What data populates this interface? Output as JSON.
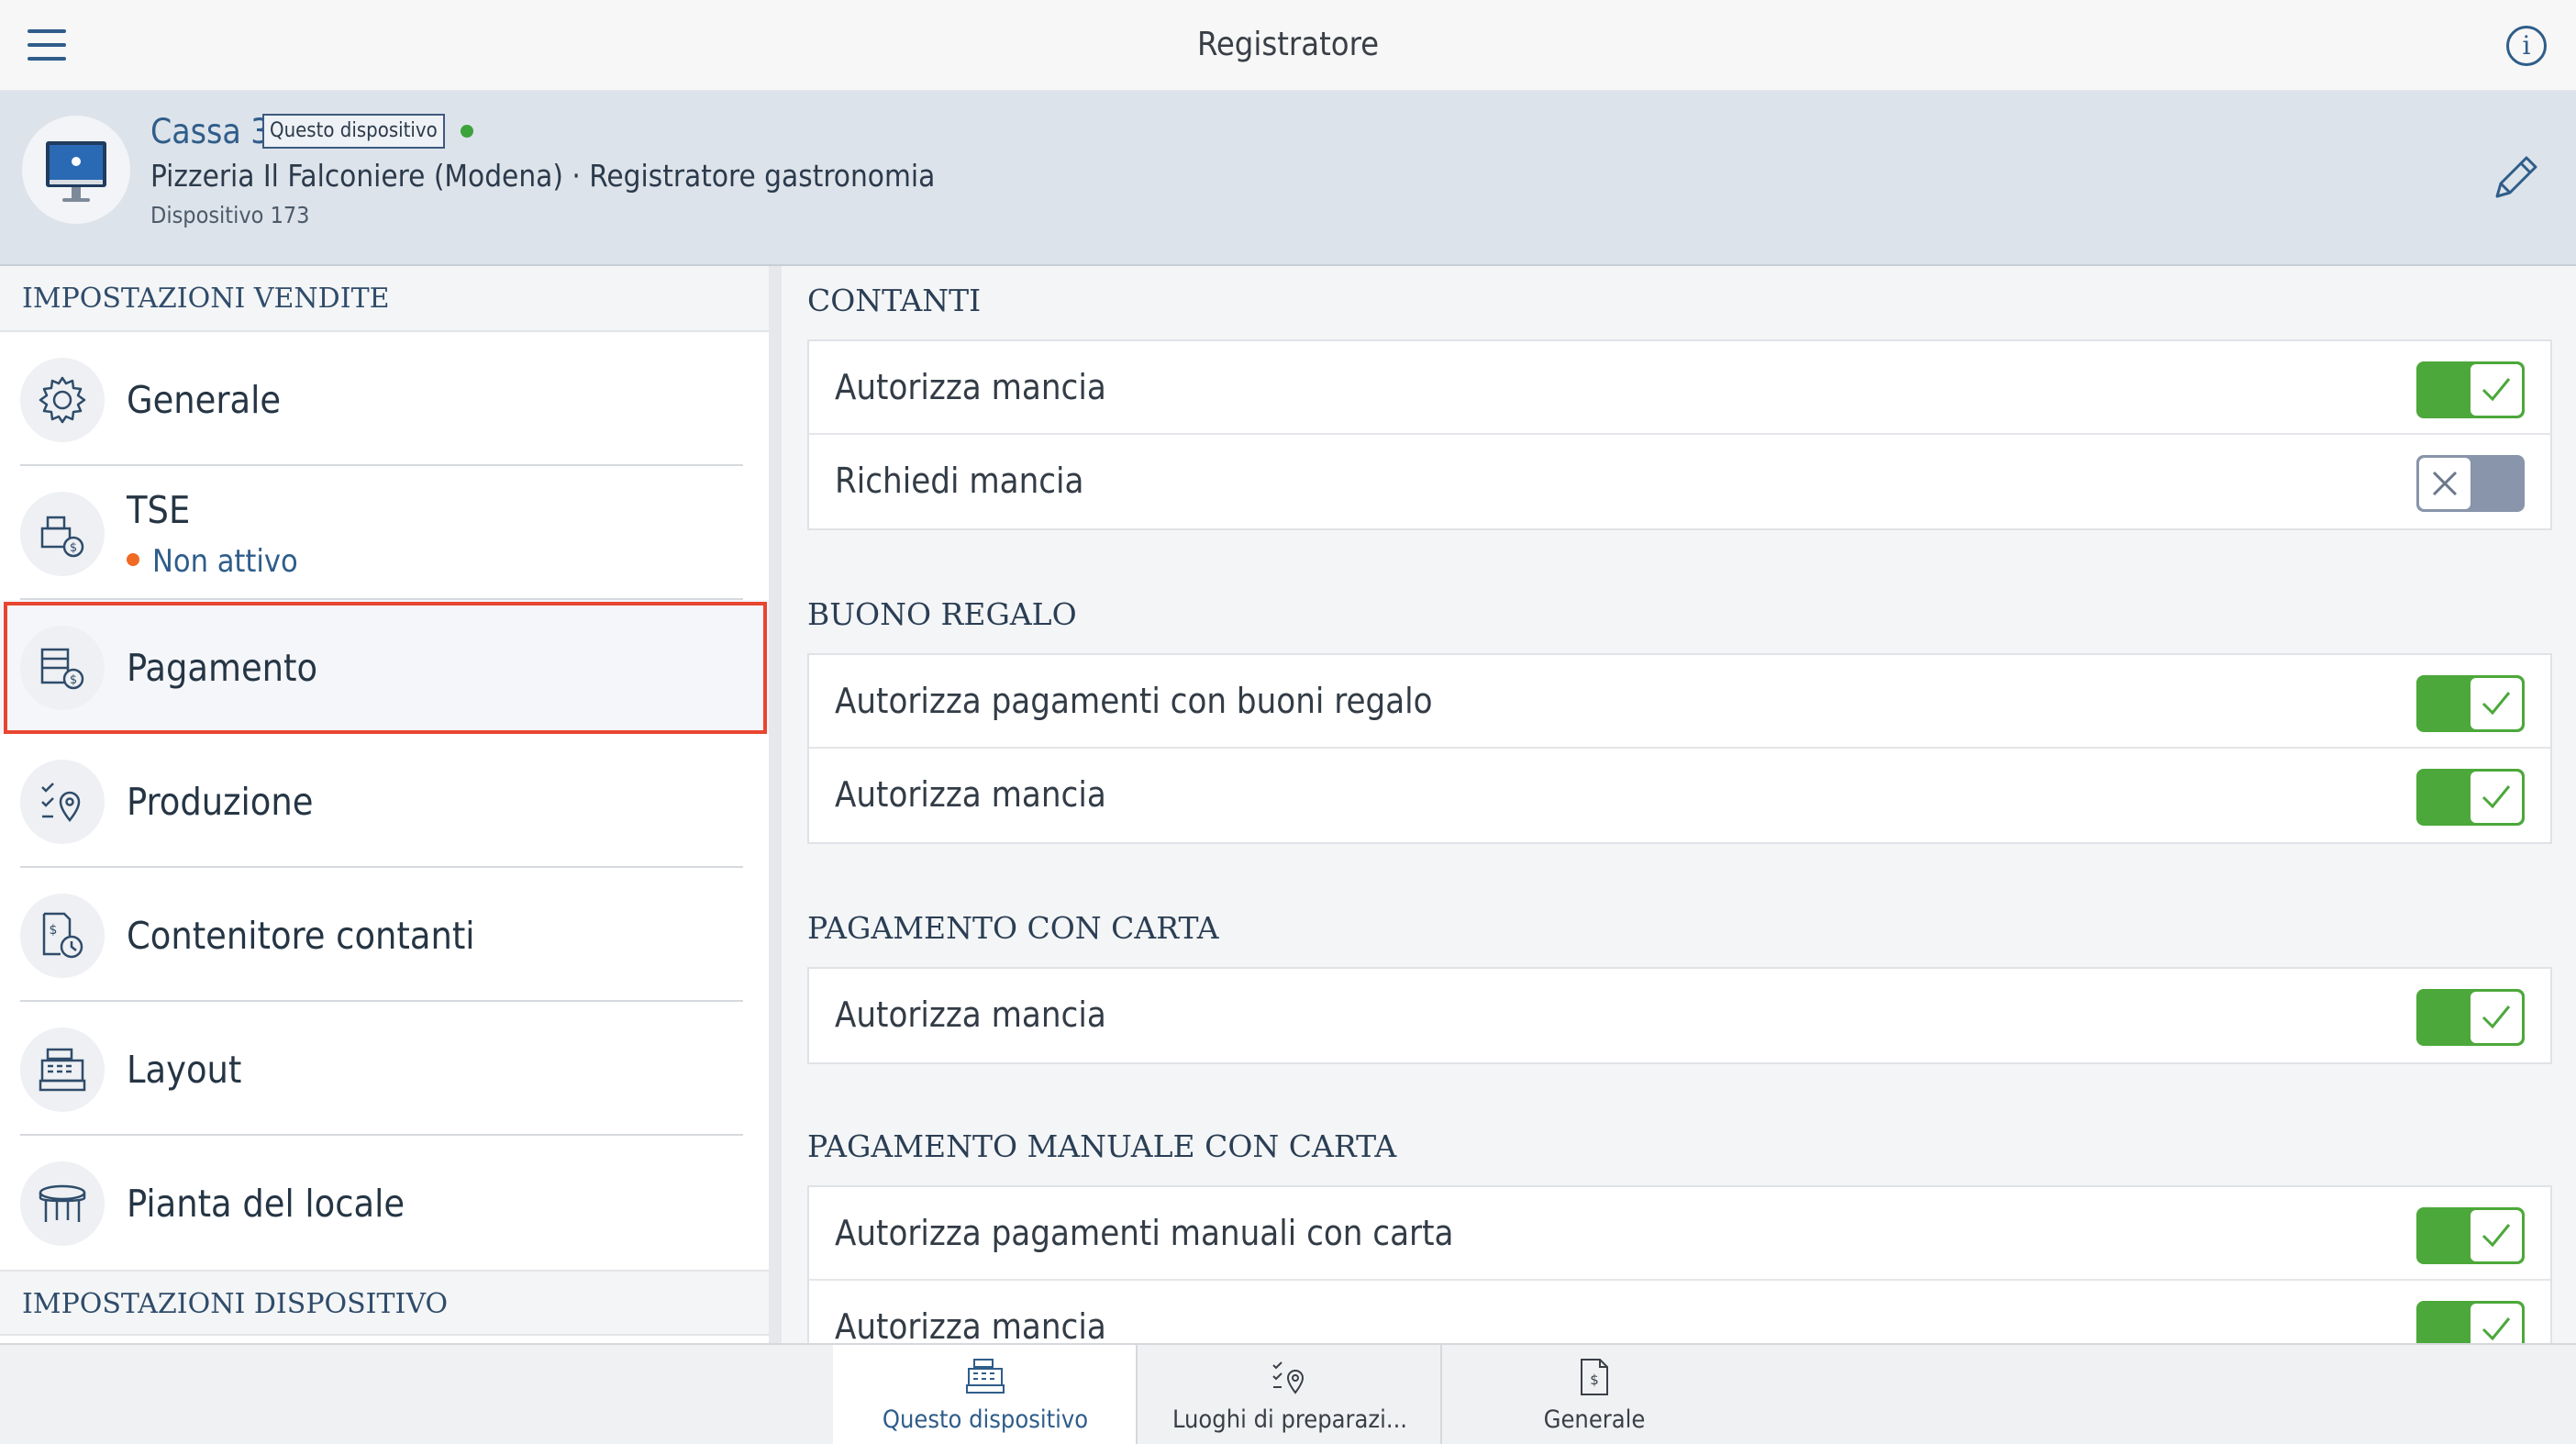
{
  "header": {
    "title": "Registratore"
  },
  "device": {
    "name": "Cassa 3",
    "badge": "Questo dispositivo",
    "location": "Pizzeria Il Falconiere (Modena) · Registratore gastronomia",
    "device_id": "Dispositivo 173"
  },
  "sidebar": {
    "section_sales": "IMPOSTAZIONI VENDITE",
    "items": [
      {
        "label": "Generale",
        "icon": "gear-icon"
      },
      {
        "label": "TSE",
        "status": "Non attivo",
        "icon": "tse-icon"
      },
      {
        "label": "Pagamento",
        "icon": "payment-icon"
      },
      {
        "label": "Produzione",
        "icon": "production-icon"
      },
      {
        "label": "Contenitore contanti",
        "icon": "cash-drawer-icon"
      },
      {
        "label": "Layout",
        "icon": "register-icon"
      },
      {
        "label": "Pianta del locale",
        "icon": "table-icon"
      }
    ],
    "section_device": "IMPOSTAZIONI DISPOSITIVO",
    "selected_index": 2
  },
  "content": {
    "sections": [
      {
        "title": "CONTANTI",
        "rows": [
          {
            "label": "Autorizza mancia",
            "on": true
          },
          {
            "label": "Richiedi mancia",
            "on": false
          }
        ]
      },
      {
        "title": "BUONO REGALO",
        "rows": [
          {
            "label": "Autorizza pagamenti con buoni regalo",
            "on": true
          },
          {
            "label": "Autorizza mancia",
            "on": true
          }
        ]
      },
      {
        "title": "PAGAMENTO CON CARTA",
        "rows": [
          {
            "label": "Autorizza mancia",
            "on": true
          }
        ]
      },
      {
        "title": "PAGAMENTO MANUALE CON CARTA",
        "rows": [
          {
            "label": "Autorizza pagamenti manuali con carta",
            "on": true
          },
          {
            "label": "Autorizza mancia",
            "on": true
          }
        ]
      }
    ]
  },
  "tabs": [
    {
      "label": "Questo dispositivo",
      "active": true
    },
    {
      "label": "Luoghi di preparazi...",
      "active": false
    },
    {
      "label": "Generale",
      "active": false
    }
  ],
  "colors": {
    "accent": "#2f5d8a",
    "toggle_on": "#4ca83a",
    "toggle_off": "#8895aa",
    "selection": "#e8452f",
    "online": "#3ca33c",
    "inactive": "#f06a23"
  }
}
